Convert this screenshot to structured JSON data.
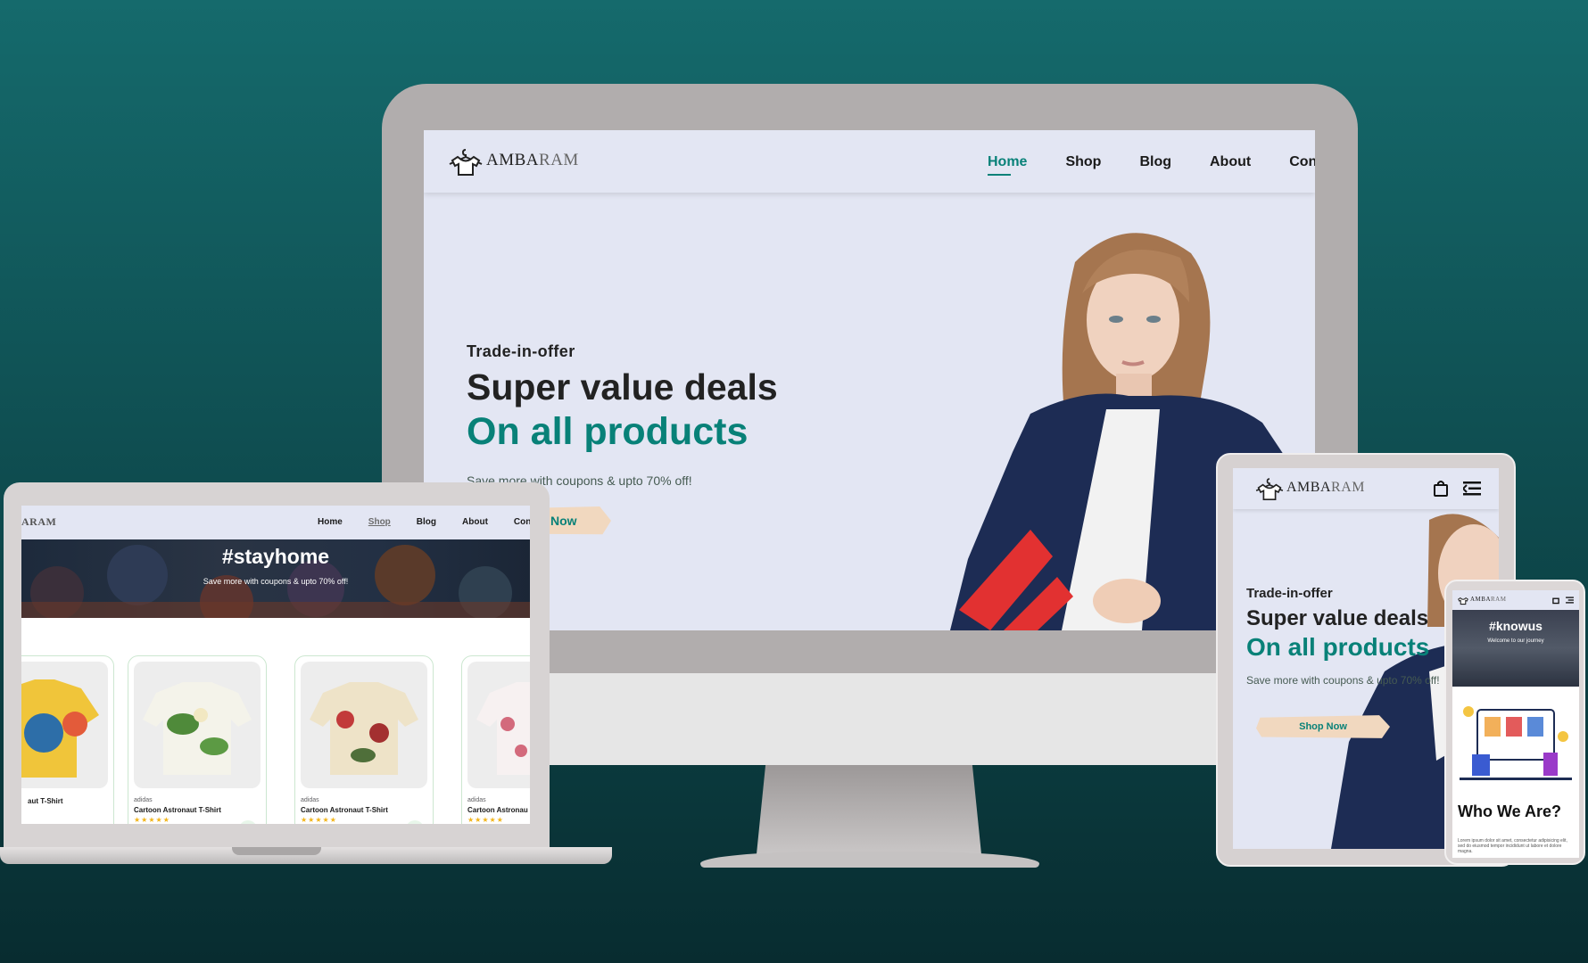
{
  "brand": {
    "logo_main": "AMBA",
    "logo_tail": "RAM",
    "accent_color": "#088178",
    "nav_bg_color": "#e3e6f3",
    "button_bg_color": "#f1d8bf"
  },
  "desktop": {
    "nav": {
      "home": "Home",
      "shop": "Shop",
      "blog": "Blog",
      "about": "About",
      "contact": "Conta"
    },
    "hero": {
      "kicker": "Trade-in-offer",
      "title": "Super value deals",
      "highlight": "On all products",
      "subtitle": "Save more with coupons & upto 70% off!",
      "button": "Now"
    }
  },
  "laptop": {
    "logo_partial": "ARAM",
    "nav": {
      "home": "Home",
      "shop": "Shop",
      "blog": "Blog",
      "about": "About",
      "contact": "Conta"
    },
    "banner": {
      "title": "#stayhome",
      "subtitle": "Save more with coupons & upto 70% off!"
    },
    "products": [
      {
        "brand": "",
        "name": "aut T-Shirt",
        "stars": ""
      },
      {
        "brand": "adidas",
        "name": "Cartoon Astronaut T-Shirt",
        "stars": "★★★★★"
      },
      {
        "brand": "adidas",
        "name": "Cartoon Astronaut T-Shirt",
        "stars": "★★★★★"
      },
      {
        "brand": "adidas",
        "name": "Cartoon Astronau",
        "stars": "★★★★★"
      }
    ]
  },
  "tablet": {
    "hero": {
      "kicker": "Trade-in-offer",
      "title": "Super value deals",
      "highlight": "On all products",
      "subtitle": "Save more with coupons & upto 70% off!",
      "button": "Shop Now"
    },
    "icons": {
      "cart": "shopping-bag-icon",
      "menu": "menu-icon"
    }
  },
  "phone": {
    "banner": {
      "title": "#knowus",
      "subtitle": "Welcome to our journey"
    },
    "section_title": "Who We Are?",
    "body": "Lorem ipsum dolor sit amet, consectetur adipisicing elit, sed do eiusmod tempor incididunt ut labore et dolore magna."
  }
}
